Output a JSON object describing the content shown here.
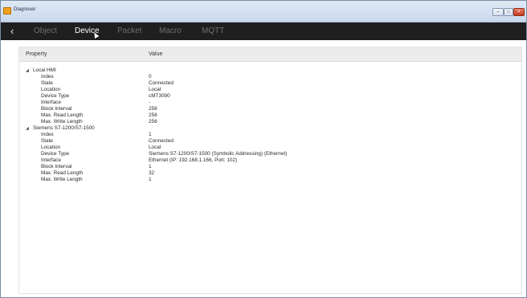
{
  "window": {
    "title": "Diagnoser"
  },
  "tabs": [
    {
      "label": "Object",
      "active": false
    },
    {
      "label": "Device",
      "active": true
    },
    {
      "label": "Packet",
      "active": false
    },
    {
      "label": "Macro",
      "active": false
    },
    {
      "label": "MQTT",
      "active": false
    }
  ],
  "table": {
    "headers": {
      "property": "Property",
      "value": "Value"
    },
    "groups": [
      {
        "name": "Local HMI",
        "expanded": true,
        "rows": [
          {
            "property": "Index",
            "value": "0"
          },
          {
            "property": "State",
            "value": "Connected"
          },
          {
            "property": "Location",
            "value": "Local"
          },
          {
            "property": "Device Type",
            "value": "cMT3090"
          },
          {
            "property": "Interface",
            "value": "-"
          },
          {
            "property": "Block Interval",
            "value": "256"
          },
          {
            "property": "Max. Read Length",
            "value": "256"
          },
          {
            "property": "Max. Write Length",
            "value": "256"
          }
        ]
      },
      {
        "name": "Siemens S7-1200/S7-1500",
        "expanded": true,
        "rows": [
          {
            "property": "Index",
            "value": "1"
          },
          {
            "property": "State",
            "value": "Connected"
          },
          {
            "property": "Location",
            "value": "Local"
          },
          {
            "property": "Device Type",
            "value": "Siemens S7-1200/S7-1500 (Symbolic Addressing) (Ethernet)"
          },
          {
            "property": "Interface",
            "value": "Ethernet (IP: 192.168.1.166, Port: 102)"
          },
          {
            "property": "Block Interval",
            "value": "1"
          },
          {
            "property": "Max. Read Length",
            "value": "32"
          },
          {
            "property": "Max. Write Length",
            "value": "1"
          }
        ]
      }
    ]
  },
  "colors": {
    "tabbar_bg": "#1f1f1f",
    "tab_active": "#ffffff",
    "tab_inactive": "#6e6e6e",
    "header_bg": "#ececec"
  },
  "icons": {
    "app": "app-icon",
    "back": "chevron-left-icon",
    "expander": "triangle-expanded-icon",
    "pointer": "mouse-cursor-icon"
  }
}
